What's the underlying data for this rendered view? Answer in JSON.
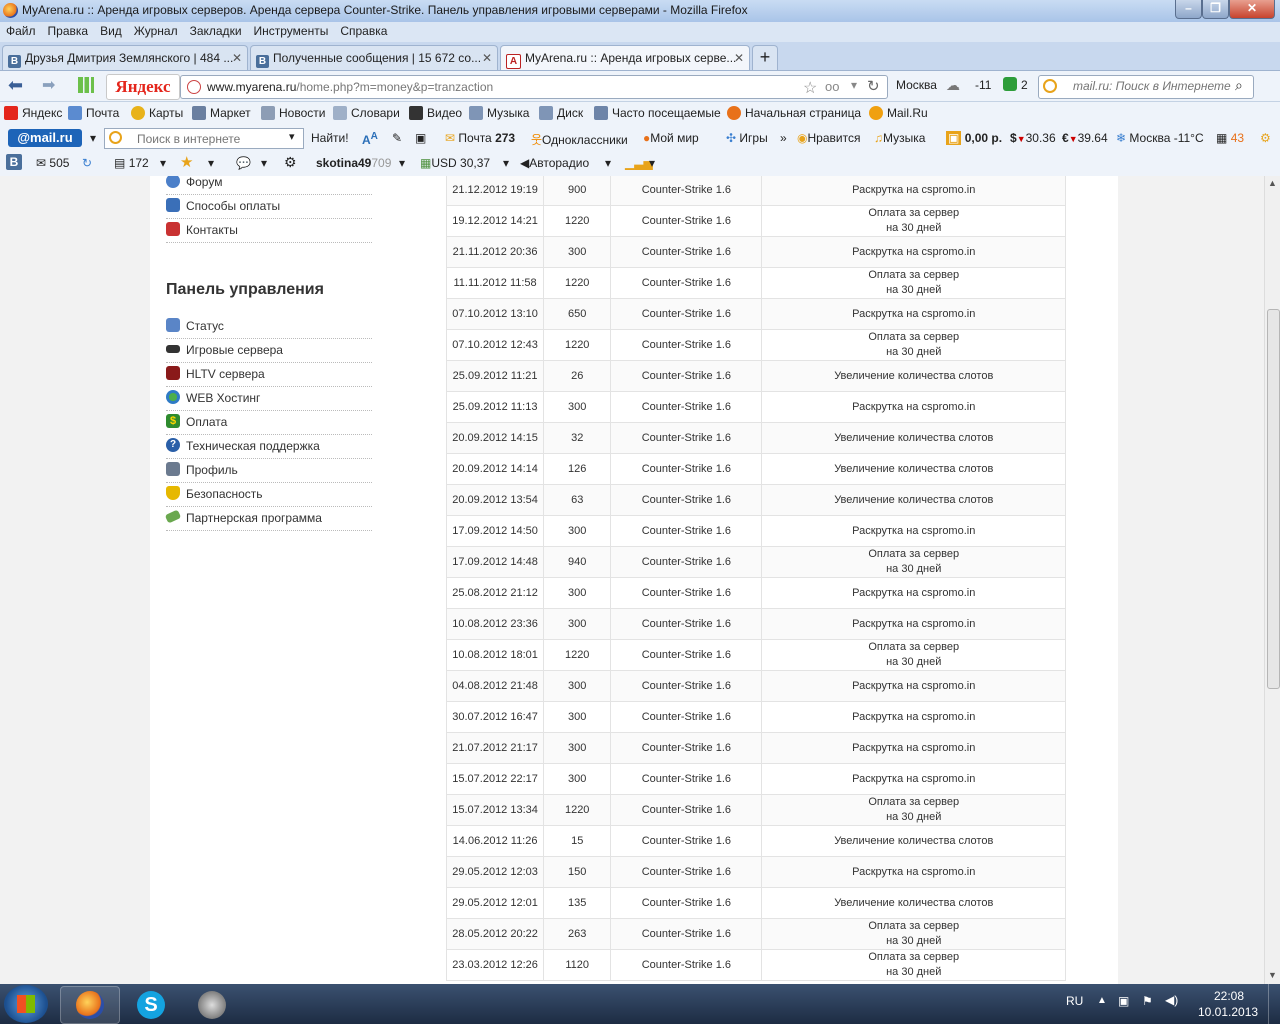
{
  "window": {
    "title": "MyArena.ru :: Аренда игровых серверов. Аренда сервера Counter-Strike. Панель управления игровыми серверами - Mozilla Firefox"
  },
  "menubar": [
    "Файл",
    "Правка",
    "Вид",
    "Журнал",
    "Закладки",
    "Инструменты",
    "Справка"
  ],
  "tabs": [
    {
      "label": "Друзья Дмитрия Землянского | 484 ...",
      "favicon": "В"
    },
    {
      "label": "Полученные сообщения | 15 672 со...",
      "favicon": "В"
    },
    {
      "label": "MyArena.ru :: Аренда игровых серве...",
      "favicon": "A"
    }
  ],
  "nav": {
    "yandex": "Яндекс",
    "url_domain": "www.myarena.ru",
    "url_path": "/home.php?m=money&p=tranzaction",
    "city": "Москва",
    "temp": "-11",
    "mail_count": "2",
    "search_placeholder": "mail.ru: Поиск в Интернете"
  },
  "bookmarks": [
    "Яндекс",
    "Почта",
    "Карты",
    "Маркет",
    "Новости",
    "Словари",
    "Видео",
    "Музыка",
    "Диск",
    "Часто посещаемые",
    "Начальная страница",
    "Mail.Ru"
  ],
  "mailbar": {
    "logo": "@mail.ru",
    "search_placeholder": "Поиск в интернете",
    "find": "Найти!",
    "mail": "Почта",
    "mail_count": "273",
    "ok": "Одноклассники",
    "moimir": "Мой мир",
    "games": "Игры",
    "likes": "Нравится",
    "music": "Музыка",
    "balance": "0,00 р.",
    "usd": "30.36",
    "eur": "39.64",
    "weather": "Москва -11°C",
    "badge": "43"
  },
  "toolbar4": {
    "mail_count": "505",
    "notes_count": "172",
    "username": "skotina49",
    "username_tail": "709",
    "usd": "USD 30,37",
    "radio": "Авторадио"
  },
  "sidebar": {
    "top_items": [
      {
        "label": "Форум",
        "color": "#4b7fc9"
      },
      {
        "label": "Способы оплаты",
        "color": "#3a6fb8"
      },
      {
        "label": "Контакты",
        "color": "#c93232"
      }
    ],
    "panel_title": "Панель управления",
    "items": [
      {
        "label": "Статус",
        "color": "#5a85c7"
      },
      {
        "label": "Игровые сервера",
        "color": "#333333"
      },
      {
        "label": "HLTV сервера",
        "color": "#8a1a1a"
      },
      {
        "label": "WEB Хостинг",
        "color": "#2f7bc6"
      },
      {
        "label": "Оплата",
        "color": "#2e8b2e"
      },
      {
        "label": "Техническая поддержка",
        "color": "#2a5fa8"
      },
      {
        "label": "Профиль",
        "color": "#6b7a8f"
      },
      {
        "label": "Безопасность",
        "color": "#e6b800"
      },
      {
        "label": "Партнерская программа",
        "color": "#6aa84f"
      }
    ]
  },
  "transactions": [
    {
      "date": "21.12.2012 19:19",
      "amount": "900",
      "game": "Counter-Strike 1.6",
      "desc": "Раскрутка на cspromo.in",
      "desc2": ""
    },
    {
      "date": "19.12.2012 14:21",
      "amount": "1220",
      "game": "Counter-Strike 1.6",
      "desc": "Оплата за сервер",
      "desc2": "на 30 дней"
    },
    {
      "date": "21.11.2012 20:36",
      "amount": "300",
      "game": "Counter-Strike 1.6",
      "desc": "Раскрутка на cspromo.in",
      "desc2": ""
    },
    {
      "date": "11.11.2012 11:58",
      "amount": "1220",
      "game": "Counter-Strike 1.6",
      "desc": "Оплата за сервер",
      "desc2": "на 30 дней"
    },
    {
      "date": "07.10.2012 13:10",
      "amount": "650",
      "game": "Counter-Strike 1.6",
      "desc": "Раскрутка на cspromo.in",
      "desc2": ""
    },
    {
      "date": "07.10.2012 12:43",
      "amount": "1220",
      "game": "Counter-Strike 1.6",
      "desc": "Оплата за сервер",
      "desc2": "на 30 дней"
    },
    {
      "date": "25.09.2012 11:21",
      "amount": "26",
      "game": "Counter-Strike 1.6",
      "desc": "Увеличение количества слотов",
      "desc2": ""
    },
    {
      "date": "25.09.2012 11:13",
      "amount": "300",
      "game": "Counter-Strike 1.6",
      "desc": "Раскрутка на cspromo.in",
      "desc2": ""
    },
    {
      "date": "20.09.2012 14:15",
      "amount": "32",
      "game": "Counter-Strike 1.6",
      "desc": "Увеличение количества слотов",
      "desc2": ""
    },
    {
      "date": "20.09.2012 14:14",
      "amount": "126",
      "game": "Counter-Strike 1.6",
      "desc": "Увеличение количества слотов",
      "desc2": ""
    },
    {
      "date": "20.09.2012 13:54",
      "amount": "63",
      "game": "Counter-Strike 1.6",
      "desc": "Увеличение количества слотов",
      "desc2": ""
    },
    {
      "date": "17.09.2012 14:50",
      "amount": "300",
      "game": "Counter-Strike 1.6",
      "desc": "Раскрутка на cspromo.in",
      "desc2": ""
    },
    {
      "date": "17.09.2012 14:48",
      "amount": "940",
      "game": "Counter-Strike 1.6",
      "desc": "Оплата за сервер",
      "desc2": "на 30 дней"
    },
    {
      "date": "25.08.2012 21:12",
      "amount": "300",
      "game": "Counter-Strike 1.6",
      "desc": "Раскрутка на cspromo.in",
      "desc2": ""
    },
    {
      "date": "10.08.2012 23:36",
      "amount": "300",
      "game": "Counter-Strike 1.6",
      "desc": "Раскрутка на cspromo.in",
      "desc2": ""
    },
    {
      "date": "10.08.2012 18:01",
      "amount": "1220",
      "game": "Counter-Strike 1.6",
      "desc": "Оплата за сервер",
      "desc2": "на 30 дней"
    },
    {
      "date": "04.08.2012 21:48",
      "amount": "300",
      "game": "Counter-Strike 1.6",
      "desc": "Раскрутка на cspromo.in",
      "desc2": ""
    },
    {
      "date": "30.07.2012 16:47",
      "amount": "300",
      "game": "Counter-Strike 1.6",
      "desc": "Раскрутка на cspromo.in",
      "desc2": ""
    },
    {
      "date": "21.07.2012 21:17",
      "amount": "300",
      "game": "Counter-Strike 1.6",
      "desc": "Раскрутка на cspromo.in",
      "desc2": ""
    },
    {
      "date": "15.07.2012 22:17",
      "amount": "300",
      "game": "Counter-Strike 1.6",
      "desc": "Раскрутка на cspromo.in",
      "desc2": ""
    },
    {
      "date": "15.07.2012 13:34",
      "amount": "1220",
      "game": "Counter-Strike 1.6",
      "desc": "Оплата за сервер",
      "desc2": "на 30 дней"
    },
    {
      "date": "14.06.2012 11:26",
      "amount": "15",
      "game": "Counter-Strike 1.6",
      "desc": "Увеличение количества слотов",
      "desc2": ""
    },
    {
      "date": "29.05.2012 12:03",
      "amount": "150",
      "game": "Counter-Strike 1.6",
      "desc": "Раскрутка на cspromo.in",
      "desc2": ""
    },
    {
      "date": "29.05.2012 12:01",
      "amount": "135",
      "game": "Counter-Strike 1.6",
      "desc": "Увеличение количества слотов",
      "desc2": ""
    },
    {
      "date": "28.05.2012 20:22",
      "amount": "263",
      "game": "Counter-Strike 1.6",
      "desc": "Оплата за сервер",
      "desc2": "на 30 дней"
    },
    {
      "date": "23.03.2012 12:26",
      "amount": "1120",
      "game": "Counter-Strike 1.6",
      "desc": "Оплата за сервер",
      "desc2": "на 30 дней"
    }
  ],
  "taskbar": {
    "lang": "RU",
    "time": "22:08",
    "date": "10.01.2013"
  }
}
